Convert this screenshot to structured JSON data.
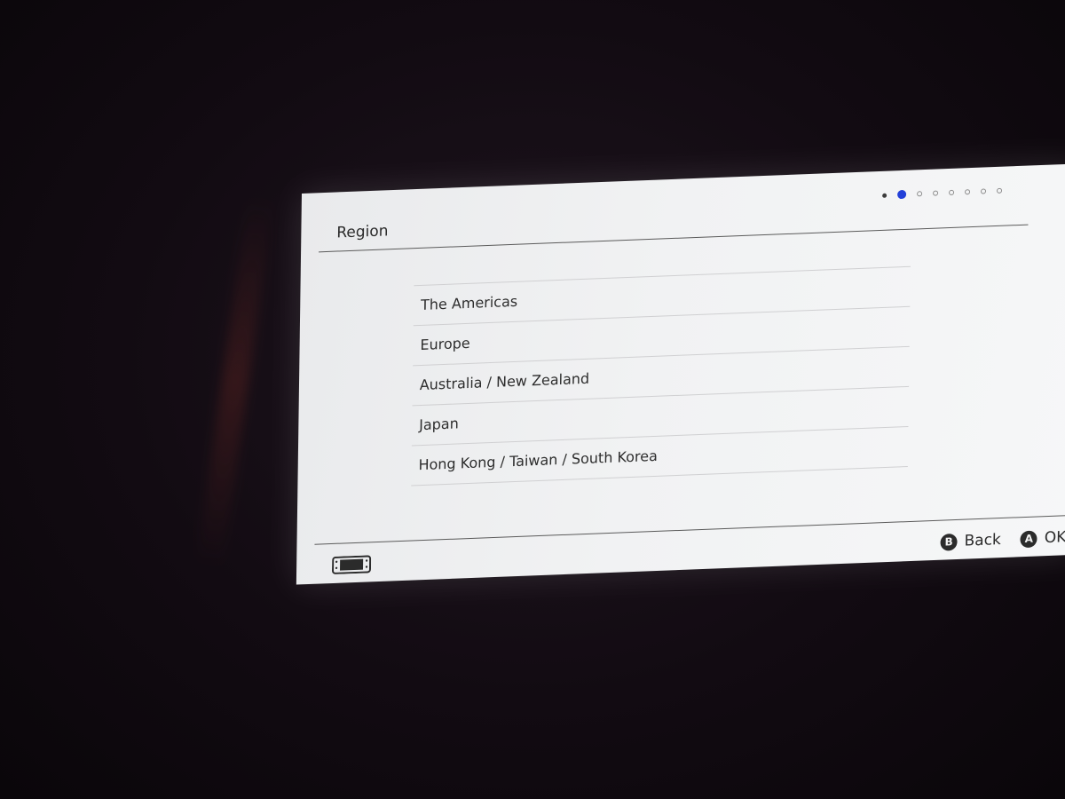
{
  "header": {
    "title": "Region",
    "pagination": {
      "total": 8,
      "current": 2
    }
  },
  "regions": [
    {
      "label": "The Americas"
    },
    {
      "label": "Europe"
    },
    {
      "label": "Australia / New Zealand"
    },
    {
      "label": "Japan"
    },
    {
      "label": "Hong Kong / Taiwan / South Korea"
    }
  ],
  "footer": {
    "console_icon": "handheld-console-icon",
    "back": {
      "glyph": "B",
      "label": "Back"
    },
    "ok": {
      "glyph": "A",
      "label": "OK"
    }
  },
  "colors": {
    "accent": "#2340d8",
    "screen_bg": "#f1f2f3",
    "text": "#2b2b2b"
  }
}
